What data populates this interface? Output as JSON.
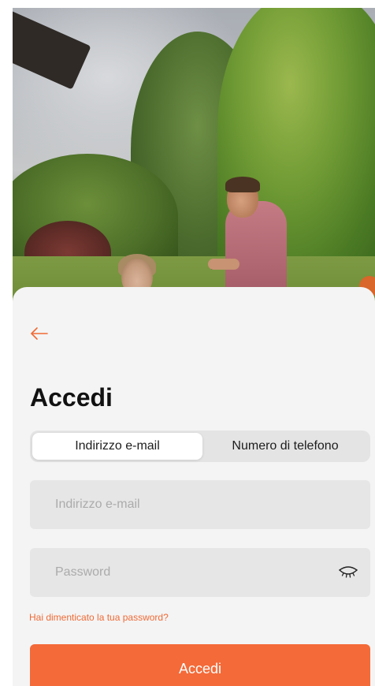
{
  "colors": {
    "accent": "#f46a38",
    "link": "#f06a35",
    "sheet_background": "#f4f4f4",
    "field_background": "#e6e6e6"
  },
  "header": {
    "back_icon": "arrow-left-icon"
  },
  "page": {
    "title": "Accedi"
  },
  "tabs": [
    {
      "label": "Indirizzo e-mail",
      "selected": true
    },
    {
      "label": "Numero di telefono",
      "selected": false
    }
  ],
  "form": {
    "email": {
      "value": "",
      "placeholder": "Indirizzo e-mail"
    },
    "password": {
      "value": "",
      "placeholder": "Password",
      "toggle_icon": "eye-closed-icon"
    },
    "forgot_link": "Hai dimenticato la tua password?",
    "submit_label": "Accedi"
  }
}
